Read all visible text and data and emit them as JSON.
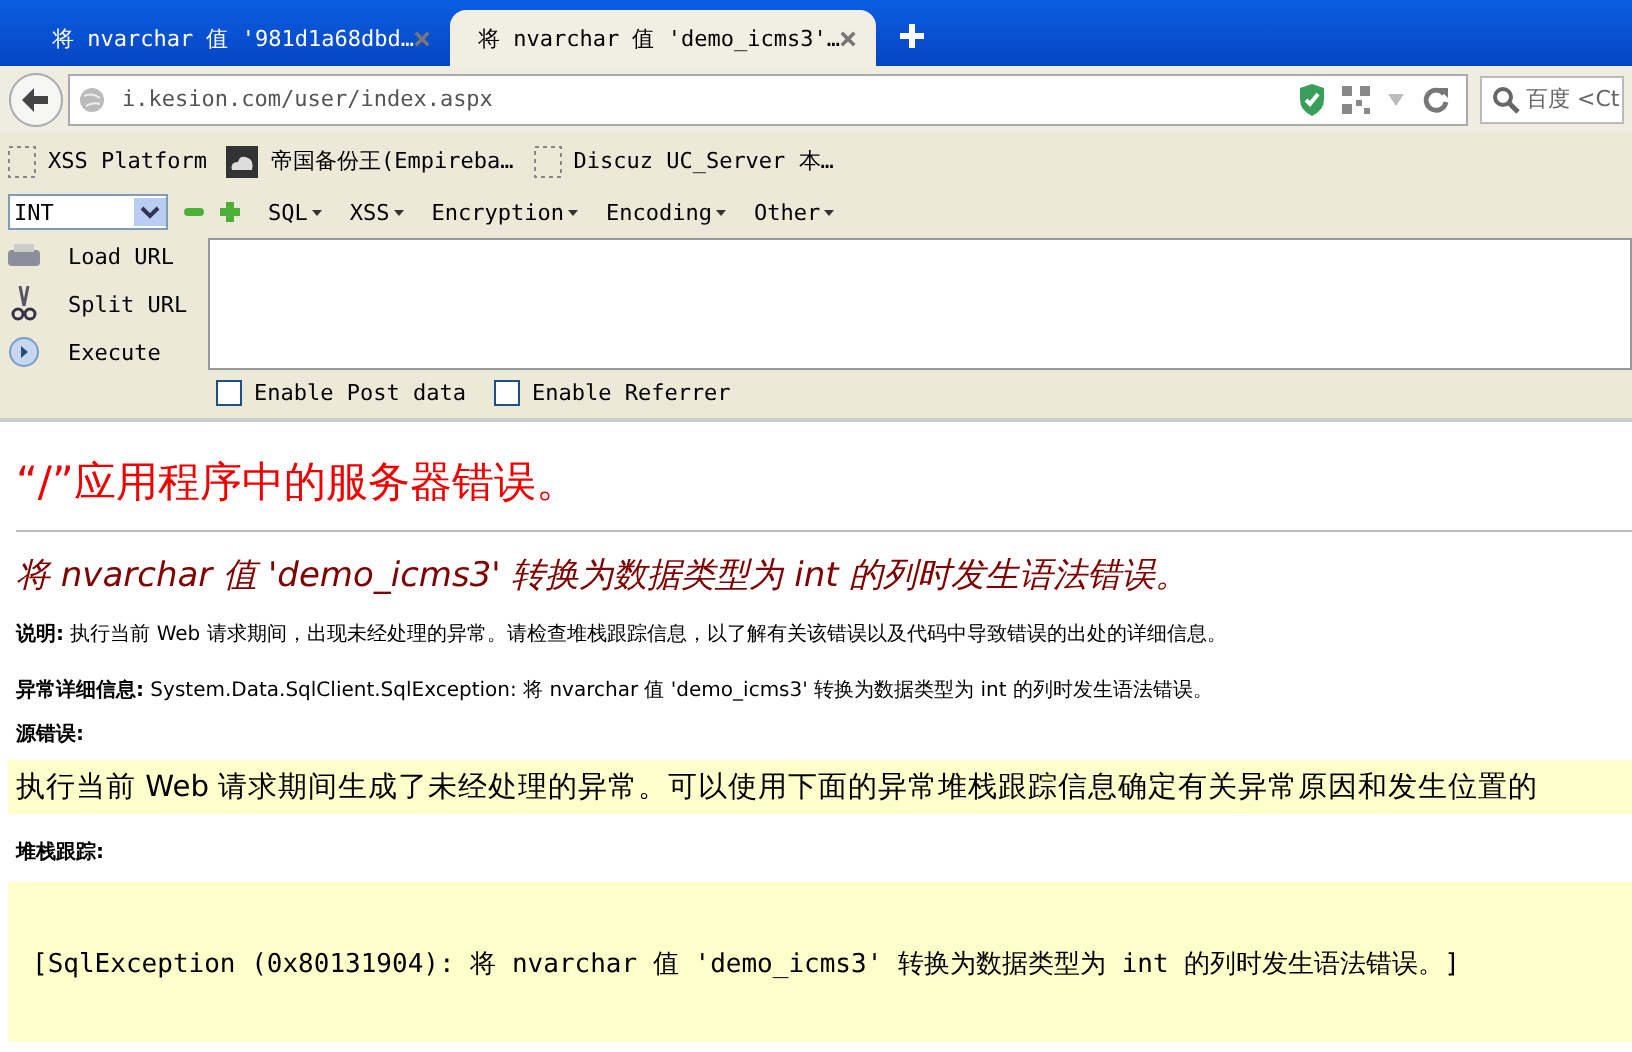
{
  "tabs": [
    {
      "title": "将 nvarchar 值 '981d1a68dbd…",
      "selected": false
    },
    {
      "title": "将 nvarchar 值 'demo_icms3'…",
      "selected": true
    }
  ],
  "address_bar": {
    "url": "i.kesion.com/user/index.aspx"
  },
  "search": {
    "placeholder": "百度 <Ct"
  },
  "bookmarks": [
    {
      "label": "XSS Platform",
      "kind": "blank"
    },
    {
      "label": "帝国备份王(Empireba…",
      "kind": "cloud"
    },
    {
      "label": "Discuz UC_Server 本…",
      "kind": "blank"
    }
  ],
  "hackbar": {
    "select": "INT",
    "menus": [
      "SQL",
      "XSS",
      "Encryption",
      "Encoding",
      "Other"
    ],
    "actions": [
      {
        "label": "Load URL",
        "kind": "load"
      },
      {
        "label": "Split URL",
        "kind": "split"
      },
      {
        "label": "Execute",
        "kind": "execute"
      }
    ],
    "options": [
      {
        "label": "Enable Post data",
        "checked": false
      },
      {
        "label": "Enable Referrer",
        "checked": false
      }
    ]
  },
  "page": {
    "title": "“/”应用程序中的服务器错误。",
    "error_heading": "将 nvarchar 值 'demo_icms3' 转换为数据类型为 int 的列时发生语法错误。",
    "description": {
      "label": "说明:",
      "text": "执行当前 Web 请求期间，出现未经处理的异常。请检查堆栈跟踪信息，以了解有关该错误以及代码中导致错误的出处的详细信息。"
    },
    "exception_details": {
      "label": "异常详细信息:",
      "text": "System.Data.SqlClient.SqlException: 将 nvarchar 值 'demo_icms3' 转换为数据类型为 int 的列时发生语法错误。"
    },
    "source_error": {
      "label": "源错误:",
      "text": "执行当前 Web 请求期间生成了未经处理的异常。可以使用下面的异常堆栈跟踪信息确定有关异常原因和发生位置的"
    },
    "stack_trace": {
      "label": "堆栈跟踪:",
      "text": "[SqlException (0x80131904): 将 nvarchar 值 'demo_icms3' 转换为数据类型为 int 的列时发生语法错误。]"
    }
  }
}
